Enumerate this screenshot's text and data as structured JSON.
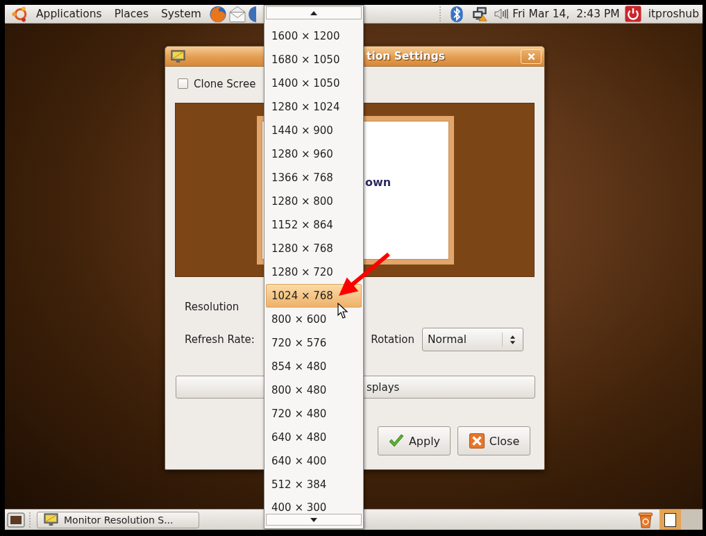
{
  "top_panel": {
    "menus": [
      {
        "label": "Applications"
      },
      {
        "label": "Places"
      },
      {
        "label": "System"
      }
    ],
    "clock": "Fri Mar 14,  2:43 PM",
    "user": "itproshub"
  },
  "dialog": {
    "title": "tion Settings",
    "clone_screen": {
      "label": "Clone Scree",
      "checked": false
    },
    "preview": {
      "monitor_label": "own"
    },
    "resolution_label": "Resolution",
    "refresh_rate_label": "Refresh Rate:",
    "rotation": {
      "label": "Rotation",
      "value": "Normal"
    },
    "detect_button": "splays",
    "buttons": [
      {
        "kind": "apply",
        "label": "Apply"
      },
      {
        "kind": "close",
        "label": "Close"
      }
    ]
  },
  "resolution_menu": {
    "items": [
      {
        "label": "1600 × 1200",
        "selected": false
      },
      {
        "label": "1680 × 1050",
        "selected": false
      },
      {
        "label": "1400 × 1050",
        "selected": false
      },
      {
        "label": "1280 × 1024",
        "selected": false
      },
      {
        "label": "1440 × 900",
        "selected": false
      },
      {
        "label": "1280 × 960",
        "selected": false
      },
      {
        "label": "1366 × 768",
        "selected": false
      },
      {
        "label": "1280 × 800",
        "selected": false
      },
      {
        "label": "1152 × 864",
        "selected": false
      },
      {
        "label": "1280 × 768",
        "selected": false
      },
      {
        "label": "1280 × 720",
        "selected": false
      },
      {
        "label": "1024 × 768",
        "selected": true
      },
      {
        "label": "800 × 600",
        "selected": false
      },
      {
        "label": "720 × 576",
        "selected": false
      },
      {
        "label": "854 × 480",
        "selected": false
      },
      {
        "label": "800 × 480",
        "selected": false
      },
      {
        "label": "720 × 480",
        "selected": false
      },
      {
        "label": "640 × 480",
        "selected": false
      },
      {
        "label": "640 × 400",
        "selected": false
      },
      {
        "label": "512 × 384",
        "selected": false
      },
      {
        "label": "400 × 300",
        "selected": false
      }
    ]
  },
  "bottom_panel": {
    "tasks": [
      {
        "label": "Monitor Resolution S..."
      }
    ],
    "workspaces": [
      {
        "selected": true,
        "has_window": true
      },
      {
        "selected": false,
        "has_window": false
      }
    ]
  }
}
